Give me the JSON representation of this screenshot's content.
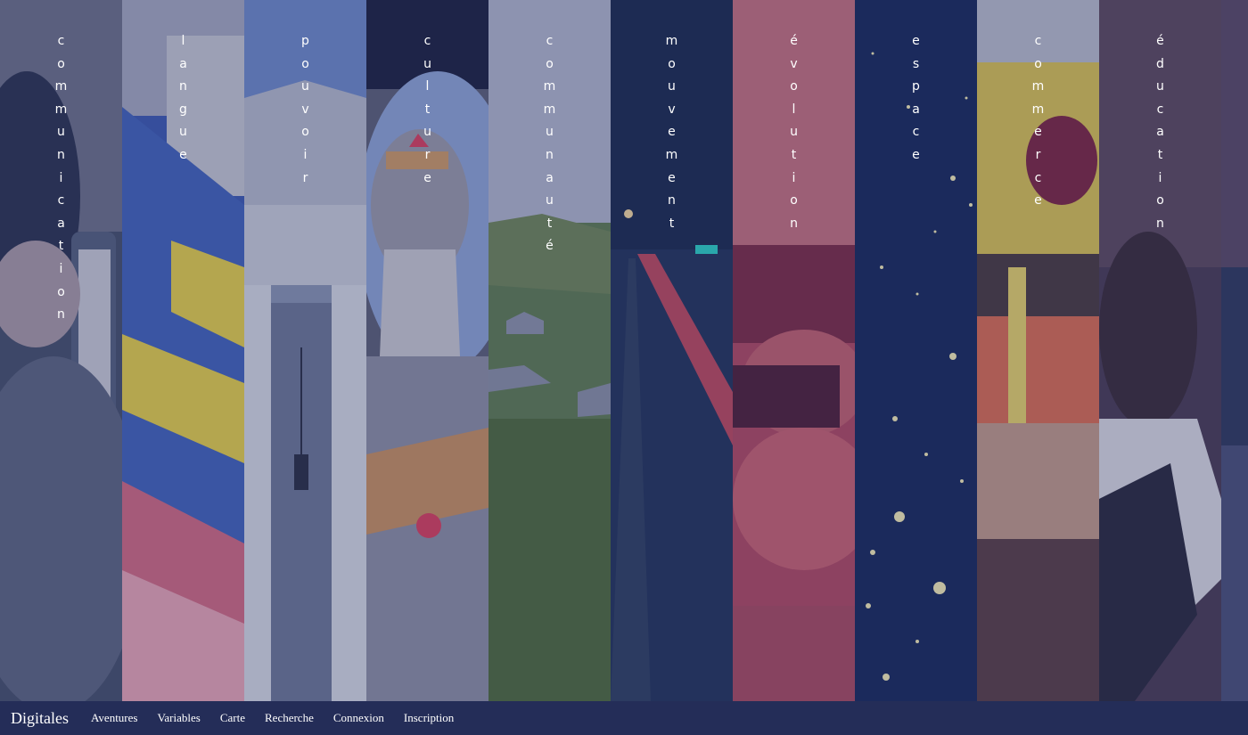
{
  "panels": [
    {
      "label": "communication",
      "color": "#3d4663",
      "accent": "#6a7088"
    },
    {
      "label": "langue",
      "color": "#3f61b6",
      "accent": "#e4cf4a"
    },
    {
      "label": "pouvoir",
      "color": "#7884a6",
      "accent": "#b6bccb"
    },
    {
      "label": "culture",
      "color": "#6a6f85",
      "accent": "#c6c7cf"
    },
    {
      "label": "communauté",
      "color": "#5f7a55",
      "accent": "#a8adc4"
    },
    {
      "label": "mouvement",
      "color": "#213258",
      "accent": "#b8485c"
    },
    {
      "label": "évolution",
      "color": "#b2495e",
      "accent": "#d88d92"
    },
    {
      "label": "espace",
      "color": "#182a5b",
      "accent": "#f4ecb6"
    },
    {
      "label": "commerce",
      "color": "#8a6a4a",
      "accent": "#d8c253"
    },
    {
      "label": "éducation",
      "color": "#4a3d55",
      "accent": "#dcdce2"
    },
    {
      "label": "",
      "color": "#3b3f63",
      "accent": "#5a5f80"
    }
  ],
  "nav": {
    "brand": "Digitales",
    "links": [
      "Aventures",
      "Variables",
      "Carte",
      "Recherche",
      "Connexion",
      "Inscription"
    ]
  }
}
